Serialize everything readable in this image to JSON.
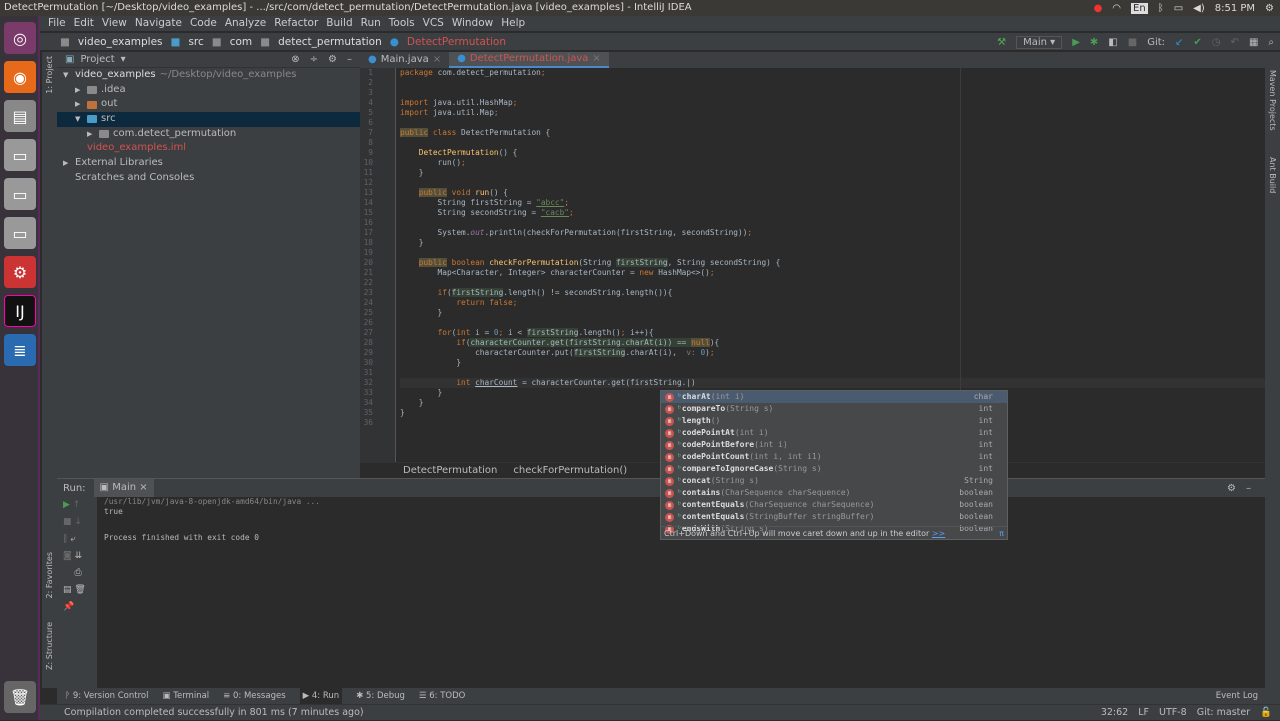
{
  "os": {
    "title": "DetectPermutation [~/Desktop/video_examples] - .../src/com/detect_permutation/DetectPermutation.java [video_examples] - IntelliJ IDEA",
    "lang": "En",
    "time": "8:51 PM"
  },
  "menu": [
    "File",
    "Edit",
    "View",
    "Navigate",
    "Code",
    "Analyze",
    "Refactor",
    "Build",
    "Run",
    "Tools",
    "VCS",
    "Window",
    "Help"
  ],
  "nav": {
    "crumbs": [
      "video_examples",
      "src",
      "com",
      "detect_permutation",
      "DetectPermutation"
    ],
    "run_config": "Main",
    "git_label": "Git:"
  },
  "project": {
    "title": "Project",
    "strip_label": "1: Project",
    "tree": [
      {
        "label": "video_examples",
        "extra": "~/Desktop/video_examples",
        "level": 0,
        "arrow": "▼",
        "color": "#ddd"
      },
      {
        "label": ".idea",
        "level": 1,
        "arrow": "▶",
        "color": "#bbb",
        "folder": "#8a8a8a"
      },
      {
        "label": "out",
        "level": 1,
        "arrow": "▶",
        "color": "#bbb",
        "folder": "#c0703a"
      },
      {
        "label": "src",
        "level": 1,
        "arrow": "▼",
        "color": "#bbb",
        "folder": "#4a9bc7",
        "selected": true
      },
      {
        "label": "com.detect_permutation",
        "level": 2,
        "arrow": "▶",
        "color": "#bbb",
        "folder": "#8a8a8a"
      },
      {
        "label": "video_examples.iml",
        "level": 1,
        "arrow": "",
        "color": "#d25252"
      },
      {
        "label": "External Libraries",
        "level": 0,
        "arrow": "▶",
        "color": "#bbb"
      },
      {
        "label": "Scratches and Consoles",
        "level": 0,
        "arrow": "",
        "color": "#bbb"
      }
    ]
  },
  "tabs": [
    {
      "label": "Main.java",
      "active": false
    },
    {
      "label": "DetectPermutation.java",
      "active": true
    }
  ],
  "code": [
    [
      [
        "kw",
        "package "
      ],
      [
        "",
        "com.detect_permutation"
      ],
      [
        "kw",
        ";"
      ]
    ],
    [],
    [],
    [
      [
        "kw",
        "import "
      ],
      [
        "",
        "java.util.HashMap"
      ],
      [
        "kw",
        ";"
      ]
    ],
    [
      [
        "kw",
        "import "
      ],
      [
        "",
        "java.util.Map"
      ],
      [
        "kw",
        ";"
      ]
    ],
    [],
    [
      [
        "kwh",
        "public"
      ],
      [
        "kw",
        " class "
      ],
      [
        "",
        "DetectPermutation {"
      ]
    ],
    [],
    [
      [
        "",
        "    "
      ],
      [
        "fn",
        "DetectPermutation"
      ],
      [
        "",
        "() {"
      ]
    ],
    [
      [
        "",
        "        run()"
      ],
      [
        "kw",
        ";"
      ]
    ],
    [
      [
        "",
        "    }"
      ]
    ],
    [],
    [
      [
        "",
        "    "
      ],
      [
        "kwh",
        "public"
      ],
      [
        "kw",
        " void "
      ],
      [
        "fn",
        "run"
      ],
      [
        "",
        "() {"
      ]
    ],
    [
      [
        "",
        "        String firstString = "
      ],
      [
        "str",
        "\"abcc\""
      ],
      [
        "kw",
        ";"
      ]
    ],
    [
      [
        "",
        "        String secondString = "
      ],
      [
        "str",
        "\"cacb\""
      ],
      [
        "kw",
        ";"
      ]
    ],
    [],
    [
      [
        "",
        "        System."
      ],
      [
        "fld",
        "out"
      ],
      [
        "",
        ".println(checkForPermutation(firstString, secondString))"
      ],
      [
        "kw",
        ";"
      ]
    ],
    [
      [
        "",
        "    }"
      ]
    ],
    [],
    [
      [
        "",
        "    "
      ],
      [
        "kwh",
        "public"
      ],
      [
        "kw",
        " boolean "
      ],
      [
        "fn",
        "checkForPermutation"
      ],
      [
        "",
        "(String "
      ],
      [
        "hl",
        "firstString"
      ],
      [
        "",
        ", String secondString) {"
      ]
    ],
    [
      [
        "",
        "        Map<Character, Integer> characterCounter = "
      ],
      [
        "kw",
        "new "
      ],
      [
        "",
        "HashMap<>()"
      ],
      [
        "kw",
        ";"
      ]
    ],
    [],
    [
      [
        "",
        "        "
      ],
      [
        "kw",
        "if"
      ],
      [
        "",
        "("
      ],
      [
        "hl",
        "firstString"
      ],
      [
        "",
        ".length() != secondString.length()){"
      ]
    ],
    [
      [
        "",
        "            "
      ],
      [
        "kw",
        "return false;"
      ]
    ],
    [
      [
        "",
        "        }"
      ]
    ],
    [],
    [
      [
        "",
        "        "
      ],
      [
        "kw",
        "for"
      ],
      [
        "",
        "("
      ],
      [
        "kw",
        "int "
      ],
      [
        "",
        "i = "
      ],
      [
        "num",
        "0"
      ],
      [
        "kw",
        "; "
      ],
      [
        "",
        "i < "
      ],
      [
        "hl",
        "firstString"
      ],
      [
        "",
        ".length()"
      ],
      [
        "kw",
        "; "
      ],
      [
        "",
        "i++){"
      ]
    ],
    [
      [
        "",
        "            "
      ],
      [
        "kw",
        "if"
      ],
      [
        "",
        "("
      ],
      [
        "hl",
        "characterCounter.get("
      ],
      [
        "hl",
        "firstString"
      ],
      [
        "hl",
        ".charAt(i)) == "
      ],
      [
        "kwh",
        "null"
      ],
      [
        "",
        "){"
      ]
    ],
    [
      [
        "",
        "                characterCounter.put("
      ],
      [
        "hl",
        "firstString"
      ],
      [
        "",
        ".charAt(i),  "
      ],
      [
        "hint",
        "v: "
      ],
      [
        "num",
        "0"
      ],
      [
        "",
        ")"
      ],
      [
        "kw",
        ";"
      ]
    ],
    [
      [
        "",
        "            }"
      ]
    ],
    [],
    [
      [
        "",
        "            "
      ],
      [
        "kw",
        "int "
      ],
      [
        "ul",
        "charCount"
      ],
      [
        "",
        " = characterCounter.get(firstString.|)"
      ]
    ],
    [
      [
        "",
        "        }"
      ]
    ],
    [
      [
        "",
        "    }"
      ]
    ],
    [
      [
        "",
        "}"
      ]
    ],
    []
  ],
  "cursor_line": 32,
  "editor_breadcrumb": [
    "DetectPermutation",
    "checkForPermutation()"
  ],
  "popup": {
    "items": [
      {
        "name": "charAt",
        "args": "(int i)",
        "type": "char"
      },
      {
        "name": "compareTo",
        "args": "(String s)",
        "type": "int"
      },
      {
        "name": "length",
        "args": "()",
        "type": "int"
      },
      {
        "name": "codePointAt",
        "args": "(int i)",
        "type": "int"
      },
      {
        "name": "codePointBefore",
        "args": "(int i)",
        "type": "int"
      },
      {
        "name": "codePointCount",
        "args": "(int i, int i1)",
        "type": "int"
      },
      {
        "name": "compareToIgnoreCase",
        "args": "(String s)",
        "type": "int"
      },
      {
        "name": "concat",
        "args": "(String s)",
        "type": "String"
      },
      {
        "name": "contains",
        "args": "(CharSequence charSequence)",
        "type": "boolean"
      },
      {
        "name": "contentEquals",
        "args": "(CharSequence charSequence)",
        "type": "boolean"
      },
      {
        "name": "contentEquals",
        "args": "(StringBuffer stringBuffer)",
        "type": "boolean"
      },
      {
        "name": "endsWith",
        "args": "(String s)",
        "type": "boolean"
      }
    ],
    "footer": "Ctrl+Down and Ctrl+Up will move caret down and up in the editor",
    "footer_link": ">>",
    "pi": "π"
  },
  "run": {
    "label": "Run:",
    "tab": "Main",
    "console": [
      "/usr/lib/jvm/java-8-openjdk-amd64/bin/java ...",
      "true",
      "",
      "Process finished with exit code 0"
    ]
  },
  "side_labels": {
    "favorites": "2: Favorites",
    "structure": "Z: Structure",
    "maven": "Maven Projects",
    "ant": "Ant Build"
  },
  "toolwindows": [
    "9: Version Control",
    "Terminal",
    "0: Messages",
    "4: Run",
    "5: Debug",
    "6: TODO"
  ],
  "event_log": "Event Log",
  "status": {
    "message": "Compilation completed successfully in 801 ms (7 minutes ago)",
    "position": "32:62",
    "line_sep": "LF",
    "encoding": "UTF-8",
    "git": "Git: master"
  }
}
